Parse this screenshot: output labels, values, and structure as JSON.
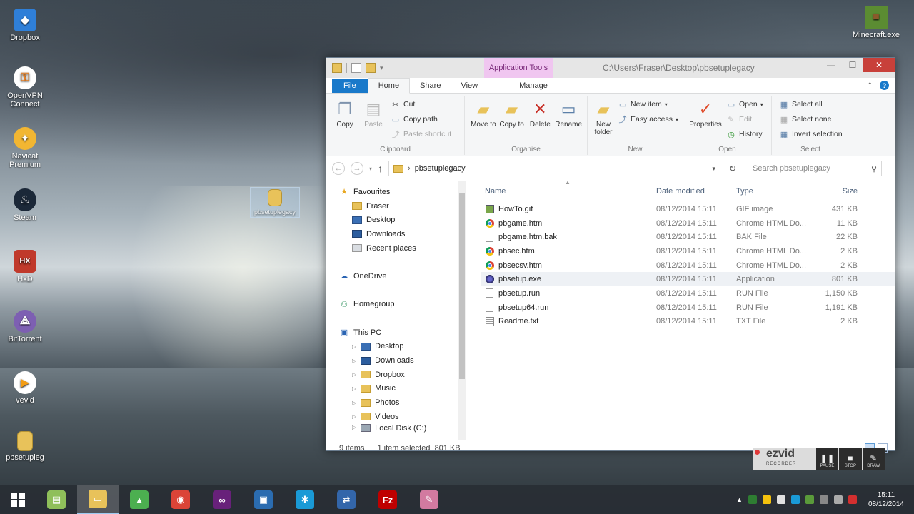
{
  "desktop": {
    "icons": [
      {
        "label": "Dropbox",
        "color": "#2f7fd8",
        "glyph": "◆"
      },
      {
        "label": "OpenVPN Connect",
        "color": "#e67e22",
        "glyph": "⚿"
      },
      {
        "label": "Navicat Premium",
        "color": "#f2b632",
        "glyph": "✦"
      },
      {
        "label": "Steam",
        "color": "#1b2838",
        "glyph": "♨"
      },
      {
        "label": "HxD",
        "color": "#c0392b",
        "glyph": "HX"
      },
      {
        "label": "BitTorrent",
        "color": "#7d5fb2",
        "glyph": "⟁"
      },
      {
        "label": "vevid",
        "color": "#f39c12",
        "glyph": "▶"
      },
      {
        "label": "pbsetupleg",
        "color": "#e8c25a",
        "glyph": ""
      },
      {
        "label": "Minecraft.exe",
        "color": "#5b8c32",
        "glyph": "■"
      }
    ],
    "drag_item_label": "pbsetuplegacy"
  },
  "window": {
    "context_tab": "Application Tools",
    "title": "C:\\Users\\Fraser\\Desktop\\pbsetuplegacy",
    "controls": {
      "minimize": "—",
      "maximize": "☐",
      "close": "✕"
    }
  },
  "ribbon": {
    "tabs": {
      "file": "File",
      "home": "Home",
      "share": "Share",
      "view": "View",
      "manage": "Manage"
    },
    "clipboard": {
      "copy": "Copy",
      "paste": "Paste",
      "cut": "Cut",
      "copy_path": "Copy path",
      "paste_shortcut": "Paste shortcut",
      "label": "Clipboard"
    },
    "organise": {
      "move_to": "Move to",
      "copy_to": "Copy to",
      "delete": "Delete",
      "rename": "Rename",
      "label": "Organise"
    },
    "new": {
      "new_folder": "New folder",
      "new_item": "New item",
      "easy_access": "Easy access",
      "label": "New"
    },
    "open": {
      "properties": "Properties",
      "open": "Open",
      "edit": "Edit",
      "history": "History",
      "label": "Open"
    },
    "select": {
      "select_all": "Select all",
      "select_none": "Select none",
      "invert": "Invert selection",
      "label": "Select"
    }
  },
  "address": {
    "crumb": "pbsetuplegacy",
    "search_placeholder": "Search pbsetuplegacy"
  },
  "nav": {
    "favourites": "Favourites",
    "fav_items": [
      "Fraser",
      "Desktop",
      "Downloads",
      "Recent places"
    ],
    "onedrive": "OneDrive",
    "homegroup": "Homegroup",
    "thispc": "This PC",
    "pc_items": [
      "Desktop",
      "Downloads",
      "Dropbox",
      "Music",
      "Photos",
      "Videos",
      "Local Disk (C:)"
    ]
  },
  "columns": {
    "name": "Name",
    "date": "Date modified",
    "type": "Type",
    "size": "Size"
  },
  "files": [
    {
      "name": "HowTo.gif",
      "date": "08/12/2014 15:11",
      "type": "GIF image",
      "size": "431 KB",
      "icon": "gif"
    },
    {
      "name": "pbgame.htm",
      "date": "08/12/2014 15:11",
      "type": "Chrome HTML Do...",
      "size": "11 KB",
      "icon": "chrome"
    },
    {
      "name": "pbgame.htm.bak",
      "date": "08/12/2014 15:11",
      "type": "BAK File",
      "size": "22 KB",
      "icon": "doc"
    },
    {
      "name": "pbsec.htm",
      "date": "08/12/2014 15:11",
      "type": "Chrome HTML Do...",
      "size": "2 KB",
      "icon": "chrome"
    },
    {
      "name": "pbsecsv.htm",
      "date": "08/12/2014 15:11",
      "type": "Chrome HTML Do...",
      "size": "2 KB",
      "icon": "chrome"
    },
    {
      "name": "pbsetup.exe",
      "date": "08/12/2014 15:11",
      "type": "Application",
      "size": "801 KB",
      "icon": "exe",
      "selected": true
    },
    {
      "name": "pbsetup.run",
      "date": "08/12/2014 15:11",
      "type": "RUN File",
      "size": "1,150 KB",
      "icon": "doc"
    },
    {
      "name": "pbsetup64.run",
      "date": "08/12/2014 15:11",
      "type": "RUN File",
      "size": "1,191 KB",
      "icon": "doc"
    },
    {
      "name": "Readme.txt",
      "date": "08/12/2014 15:11",
      "type": "TXT File",
      "size": "2 KB",
      "icon": "txt"
    }
  ],
  "status": {
    "count": "9 items",
    "selection": "1 item selected  801 KB"
  },
  "recorder": {
    "logo": "ezvid",
    "sub": "RECORDER",
    "pause": "PAUSE",
    "stop": "STOP",
    "draw": "DRAW"
  },
  "taskbar": {
    "apps": [
      {
        "name": "file-manager",
        "color": "#8fbf5a",
        "glyph": "▤"
      },
      {
        "name": "explorer",
        "color": "#e8c25a",
        "glyph": "▭",
        "active": true
      },
      {
        "name": "image-editor",
        "color": "#4caf50",
        "glyph": "▲"
      },
      {
        "name": "chrome",
        "color": "#db4437",
        "glyph": "◉"
      },
      {
        "name": "visual-studio",
        "color": "#68217a",
        "glyph": "∞"
      },
      {
        "name": "network-tool",
        "color": "#2b6cb0",
        "glyph": "▣"
      },
      {
        "name": "teamspeak",
        "color": "#1a9ad6",
        "glyph": "✱"
      },
      {
        "name": "network-connection",
        "color": "#3366aa",
        "glyph": "⇄"
      },
      {
        "name": "filezilla",
        "color": "#bf0000",
        "glyph": "Fz"
      },
      {
        "name": "paint-tool",
        "color": "#d27aa0",
        "glyph": "✎"
      }
    ],
    "time": "15:11",
    "date": "08/12/2014"
  }
}
